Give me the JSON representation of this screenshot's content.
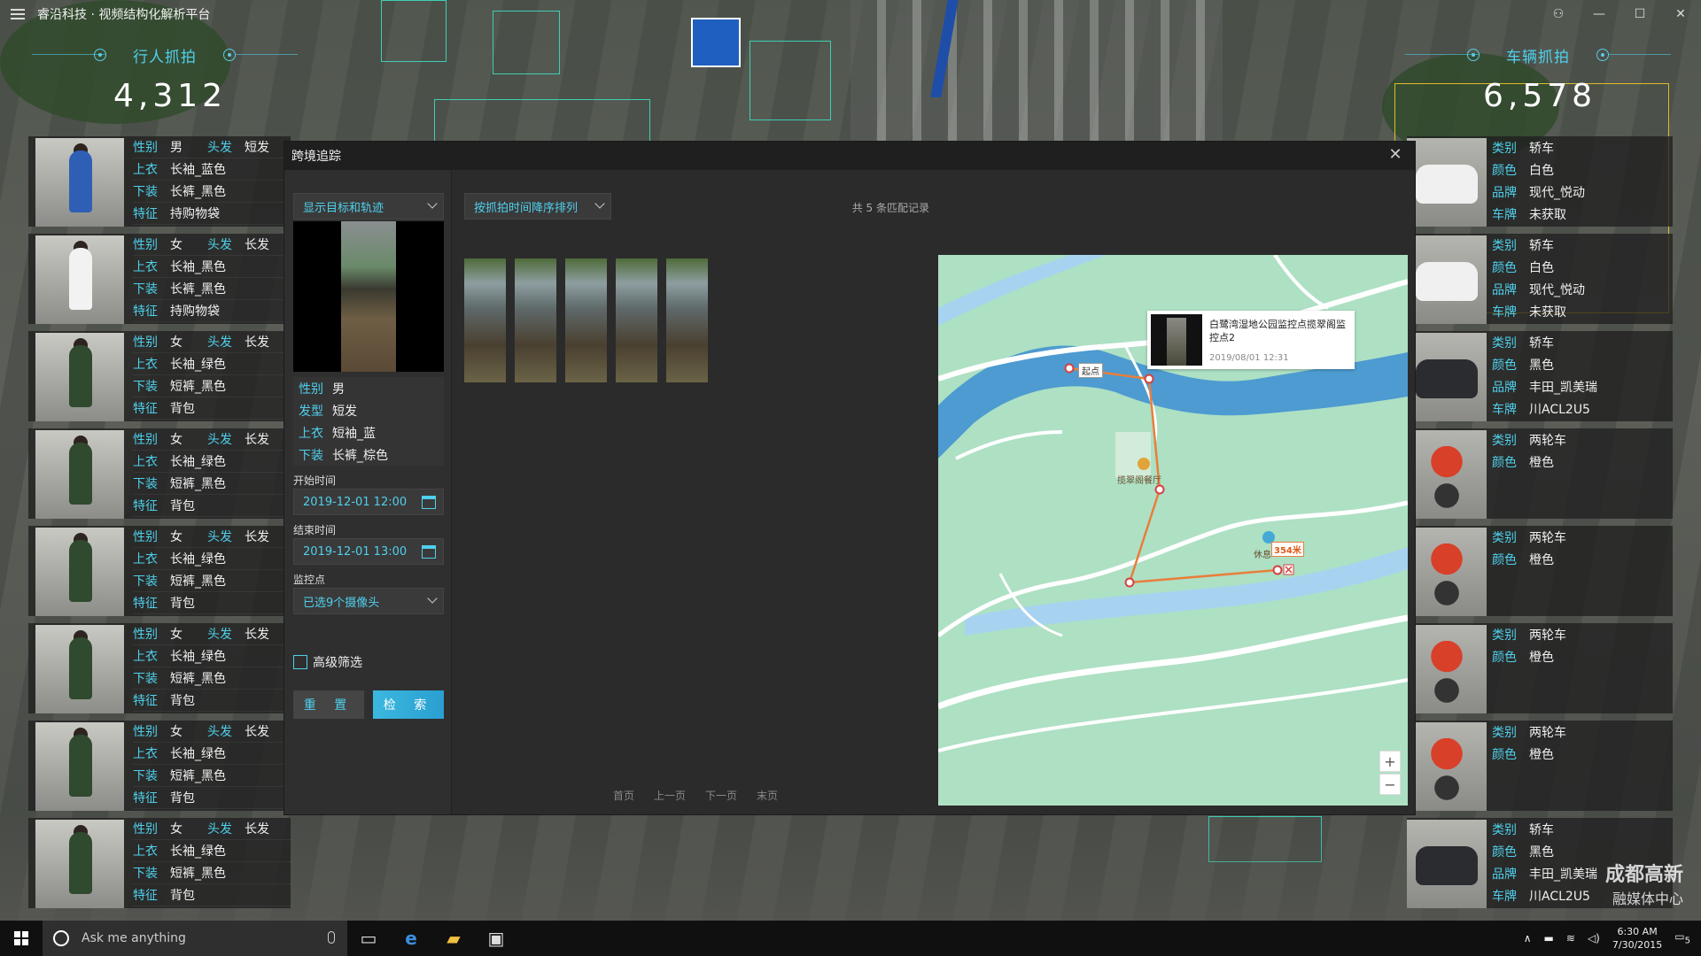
{
  "app": {
    "title": "睿沿科技 · 视频结构化解析平台"
  },
  "pedestrian": {
    "title": "行人抓拍",
    "count": "4,312",
    "field_labels": {
      "gender": "性别",
      "hair": "头发",
      "top": "上衣",
      "bottom": "下装",
      "feature": "特征"
    },
    "cards": [
      {
        "gender": "男",
        "hair": "短发",
        "top": "长袖_蓝色",
        "bottom": "长裤_黑色",
        "feature": "持购物袋",
        "color": "#2f5fb5"
      },
      {
        "gender": "女",
        "hair": "长发",
        "top": "长袖_黑色",
        "bottom": "长裤_黑色",
        "feature": "持购物袋",
        "color": "#f2f2f2"
      },
      {
        "gender": "女",
        "hair": "长发",
        "top": "长袖_绿色",
        "bottom": "短裤_黑色",
        "feature": "背包",
        "color": "#2f4a2e"
      },
      {
        "gender": "女",
        "hair": "长发",
        "top": "长袖_绿色",
        "bottom": "短裤_黑色",
        "feature": "背包",
        "color": "#2f4a2e"
      },
      {
        "gender": "女",
        "hair": "长发",
        "top": "长袖_绿色",
        "bottom": "短裤_黑色",
        "feature": "背包",
        "color": "#2f4a2e"
      },
      {
        "gender": "女",
        "hair": "长发",
        "top": "长袖_绿色",
        "bottom": "短裤_黑色",
        "feature": "背包",
        "color": "#2f4a2e"
      },
      {
        "gender": "女",
        "hair": "长发",
        "top": "长袖_绿色",
        "bottom": "短裤_黑色",
        "feature": "背包",
        "color": "#2f4a2e"
      },
      {
        "gender": "女",
        "hair": "长发",
        "top": "长袖_绿色",
        "bottom": "短裤_黑色",
        "feature": "背包",
        "color": "#2f4a2e"
      }
    ]
  },
  "vehicle": {
    "title": "车辆抓拍",
    "count": "6,578",
    "field_labels": {
      "type": "类别",
      "color": "颜色",
      "brand": "品牌",
      "plate": "车牌"
    },
    "cards": [
      {
        "type": "轿车",
        "color": "白色",
        "brand": "现代_悦动",
        "plate": "未获取",
        "kind": "car",
        "fill": "#f0f0f0"
      },
      {
        "type": "轿车",
        "color": "白色",
        "brand": "现代_悦动",
        "plate": "未获取",
        "kind": "car",
        "fill": "#f0f0f0"
      },
      {
        "type": "轿车",
        "color": "黑色",
        "brand": "丰田_凯美瑞",
        "plate": "川ACL2U5",
        "kind": "car",
        "fill": "#2a2c30"
      },
      {
        "type": "两轮车",
        "color": "橙色",
        "kind": "bike",
        "fill": "#d8402a"
      },
      {
        "type": "两轮车",
        "color": "橙色",
        "kind": "bike",
        "fill": "#d8402a"
      },
      {
        "type": "两轮车",
        "color": "橙色",
        "kind": "bike",
        "fill": "#d8402a"
      },
      {
        "type": "两轮车",
        "color": "橙色",
        "kind": "bike",
        "fill": "#d8402a"
      },
      {
        "type": "轿车",
        "color": "黑色",
        "brand": "丰田_凯美瑞",
        "plate": "川ACL2U5",
        "kind": "car",
        "fill": "#2a2c30"
      }
    ]
  },
  "dialog": {
    "title": "跨境追踪",
    "display_mode": "显示目标和轨迹",
    "sort_mode": "按抓拍时间降序排列",
    "match_count": "共 5 条匹配记录",
    "target_attrs": [
      {
        "k": "性别",
        "v": "男"
      },
      {
        "k": "发型",
        "v": "短发"
      },
      {
        "k": "上衣",
        "v": "短袖_蓝"
      },
      {
        "k": "下装",
        "v": "长裤_棕色"
      }
    ],
    "start_label": "开始时间",
    "start_value": "2019-12-01  12:00",
    "end_label": "结束时间",
    "end_value": "2019-12-01  13:00",
    "camera_label": "监控点",
    "camera_value": "已选9个摄像头",
    "advanced_filter": "高级筛选",
    "reset_btn": "重 置",
    "search_btn": "检 索",
    "pager": {
      "first": "首页",
      "prev": "上一页",
      "next": "下一页",
      "last": "末页"
    },
    "map": {
      "popup_title": "白鹭湾湿地公园监控点揽翠阁监控点2",
      "popup_time": "2019/08/01  12:31",
      "start_tag": "起点",
      "poi": "揽翠阁餐厅",
      "poi2": "休息",
      "distance": "354米",
      "zoom_in": "+",
      "zoom_out": "−"
    }
  },
  "taskbar": {
    "search_placeholder": "Ask me anything",
    "time": "6:30 AM",
    "date": "7/30/2015",
    "notif_count": "5"
  },
  "watermark": {
    "line1": "成都高新",
    "line2": "融媒体中心"
  }
}
